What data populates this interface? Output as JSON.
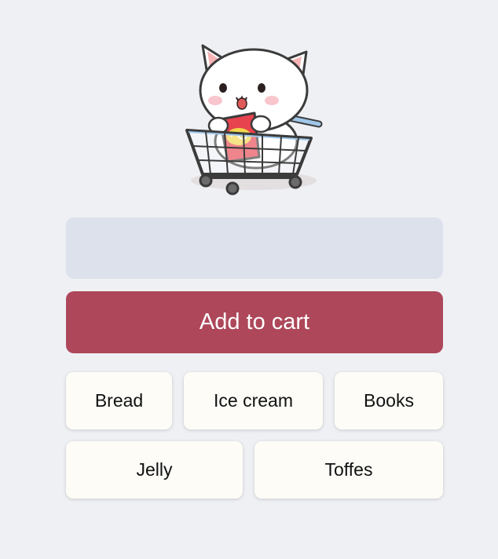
{
  "mascot": {
    "icon": "cat-in-shopping-cart-icon"
  },
  "item_input": {
    "value": "",
    "placeholder": ""
  },
  "add_button": {
    "label": "Add to cart"
  },
  "suggestions": [
    "Bread",
    "Ice cream",
    "Books",
    "Jelly",
    "Toffes"
  ],
  "colors": {
    "background": "#eef0f4",
    "input_background": "#dde1eb",
    "accent": "#ad4759",
    "chip_background": "#fdfcf7"
  }
}
